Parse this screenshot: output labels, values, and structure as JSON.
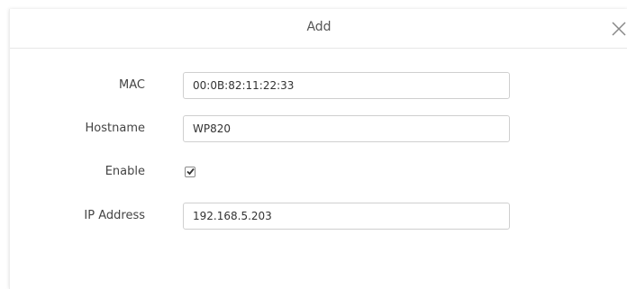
{
  "dialog": {
    "title": "Add",
    "close_icon": "close-icon"
  },
  "form": {
    "mac": {
      "label": "MAC",
      "value": "00:0B:82:11:22:33"
    },
    "hostname": {
      "label": "Hostname",
      "value": "WP820"
    },
    "enable": {
      "label": "Enable",
      "checked": true
    },
    "ip_address": {
      "label": "IP Address",
      "value": "192.168.5.203"
    }
  }
}
